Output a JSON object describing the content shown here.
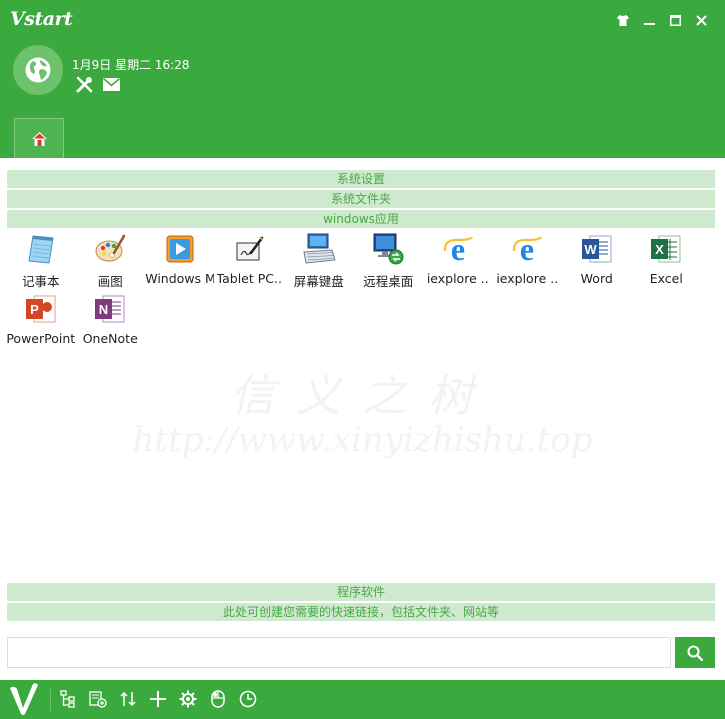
{
  "app": {
    "logo": "Vstart"
  },
  "header": {
    "datetime": "1月9日 星期二 16:28"
  },
  "sections": {
    "system_settings": "系统设置",
    "system_folders": "系统文件夹",
    "windows_apps": "windows应用",
    "programs": "程序软件",
    "hint": "此处可创建您需要的快速链接，包括文件夹、网站等"
  },
  "apps": [
    {
      "label": "记事本",
      "icon": "notepad-icon"
    },
    {
      "label": "画图",
      "icon": "paint-icon"
    },
    {
      "label": "Windows M..",
      "icon": "media-player-icon"
    },
    {
      "label": "Tablet PC..",
      "icon": "tablet-pc-icon"
    },
    {
      "label": "屏幕键盘",
      "icon": "on-screen-keyboard-icon"
    },
    {
      "label": "远程桌面",
      "icon": "remote-desktop-icon"
    },
    {
      "label": "iexplore ..",
      "icon": "internet-explorer-icon"
    },
    {
      "label": "iexplore ..",
      "icon": "internet-explorer-icon"
    },
    {
      "label": "Word",
      "icon": "word-icon"
    },
    {
      "label": "Excel",
      "icon": "excel-icon"
    },
    {
      "label": "PowerPoint",
      "icon": "powerpoint-icon"
    },
    {
      "label": "OneNote",
      "icon": "onenote-icon"
    }
  ],
  "watermark": {
    "line1": "信义之树",
    "line2": "http://www.xinyizhishu.top"
  },
  "search": {
    "value": "",
    "placeholder": ""
  },
  "colors": {
    "brand": "#3aaa3f",
    "section_bar": "#cfe9cf",
    "section_text": "#48a848"
  }
}
